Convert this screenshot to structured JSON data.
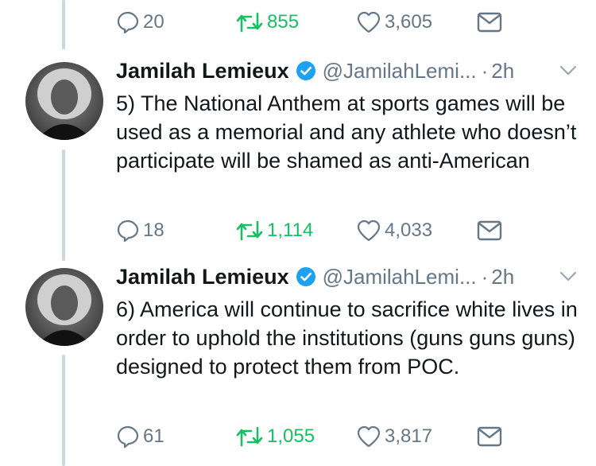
{
  "top_actions": {
    "replies": "20",
    "retweets": "855",
    "likes": "3,605"
  },
  "tweets": [
    {
      "name": "Jamilah Lemieux",
      "handle": "@JamilahLemi...",
      "dot": "·",
      "time": "2h",
      "text": "5) The National Anthem at sports games will be used as a memorial and any athlete who doesn’t participate will be shamed as anti-American",
      "replies": "18",
      "retweets": "1,114",
      "likes": "4,033"
    },
    {
      "name": "Jamilah Lemieux",
      "handle": "@JamilahLemi...",
      "dot": "·",
      "time": "2h",
      "text": "6) America will continue to sacrifice white lives in order to uphold the institutions (guns guns guns) designed to protect them from POC.",
      "replies": "61",
      "retweets": "1,055",
      "likes": "3,817"
    }
  ],
  "icons": [
    "reply-icon",
    "retweet-icon",
    "like-icon",
    "dm-icon",
    "verified-icon",
    "chevron-down-icon"
  ],
  "colors": {
    "retweet": "#17bf63",
    "muted": "#657786",
    "verified": "#1da1f2",
    "thread_line": "#ccd6dd"
  }
}
